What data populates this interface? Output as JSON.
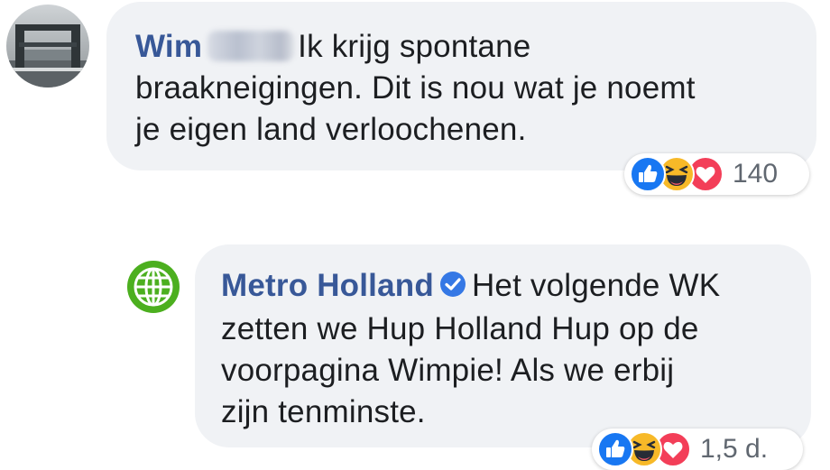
{
  "comments": [
    {
      "author": "Wim",
      "author_surname_redacted": true,
      "text_line1": "Ik krijg spontane",
      "text_line2": "braakneigingen. Dit is nou wat je noemt",
      "text_line3": "je eigen land verloochenen.",
      "reactions": [
        "like-icon",
        "haha-icon",
        "love-icon"
      ],
      "reaction_count": "140",
      "avatar": "bridge-photo-avatar"
    },
    {
      "author": "Metro Holland",
      "verified": true,
      "text_line1": "Het volgende WK",
      "text_line2": "zetten we Hup Holland Hup op de",
      "text_line3": "voorpagina Wimpie! Als we erbij",
      "text_line4": "zijn tenminste.",
      "reactions": [
        "like-icon",
        "haha-icon",
        "love-icon"
      ],
      "reaction_meta": "1,5 d.",
      "avatar": "globe-logo-avatar"
    }
  ],
  "colors": {
    "bubble": "#f0f2f5",
    "author": "#385898",
    "like": "#1877f2",
    "haha": "#f7b928",
    "love": "#f33e58",
    "metro_green": "#4caf1f",
    "verified": "#3578e5"
  }
}
